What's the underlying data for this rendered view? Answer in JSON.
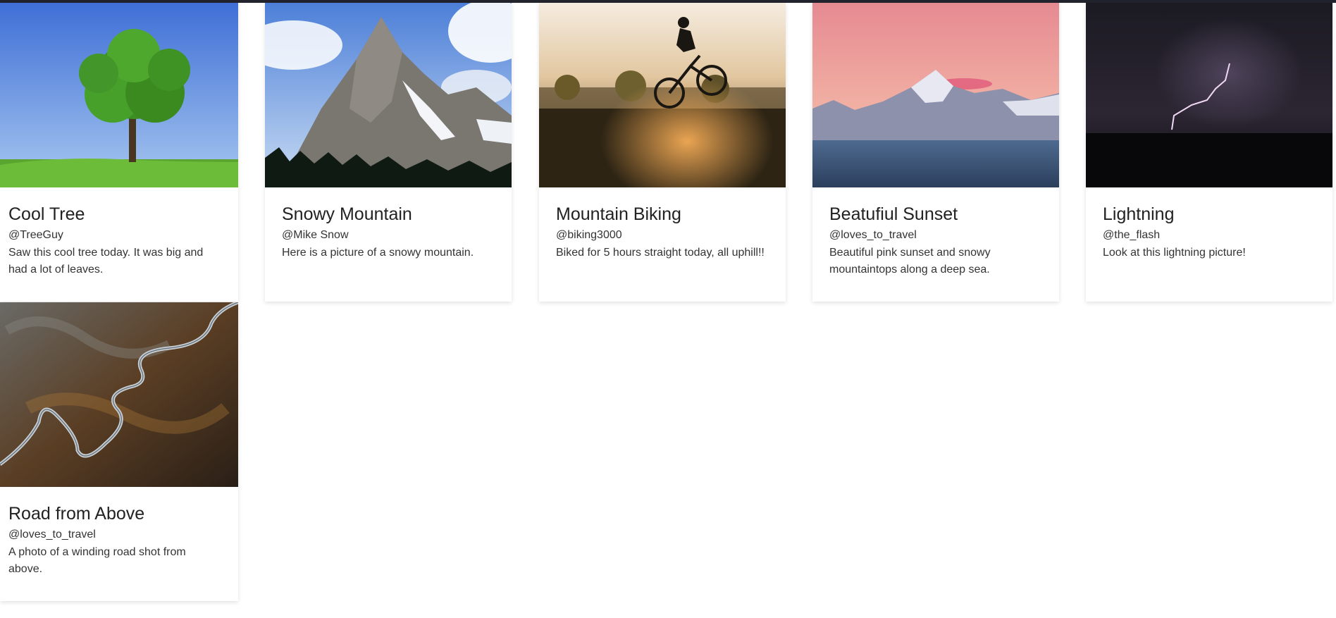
{
  "posts": [
    {
      "title": "Cool Tree",
      "user": "@TreeGuy",
      "description": "Saw this cool tree today. It was big and had a lot of leaves.",
      "image": "tree-photo"
    },
    {
      "title": "Snowy Mountain",
      "user": "@Mike Snow",
      "description": "Here is a picture of a snowy mountain.",
      "image": "snowy-mountain-photo"
    },
    {
      "title": "Mountain Biking",
      "user": "@biking3000",
      "description": "Biked for 5 hours straight today, all uphill!!",
      "image": "mountain-biker-photo"
    },
    {
      "title": "Beatufiul Sunset",
      "user": "@loves_to_travel",
      "description": "Beautiful pink sunset and snowy mountaintops along a deep sea.",
      "image": "pink-sunset-photo"
    },
    {
      "title": "Lightning",
      "user": "@the_flash",
      "description": "Look at this lightning picture!",
      "image": "lightning-photo"
    },
    {
      "title": "Road from Above",
      "user": "@loves_to_travel",
      "description": "A photo of a winding road shot from above.",
      "image": "winding-road-photo"
    }
  ],
  "colors": {
    "topbar": "#23232e",
    "title_text": "#222222",
    "body_text": "#333333"
  }
}
